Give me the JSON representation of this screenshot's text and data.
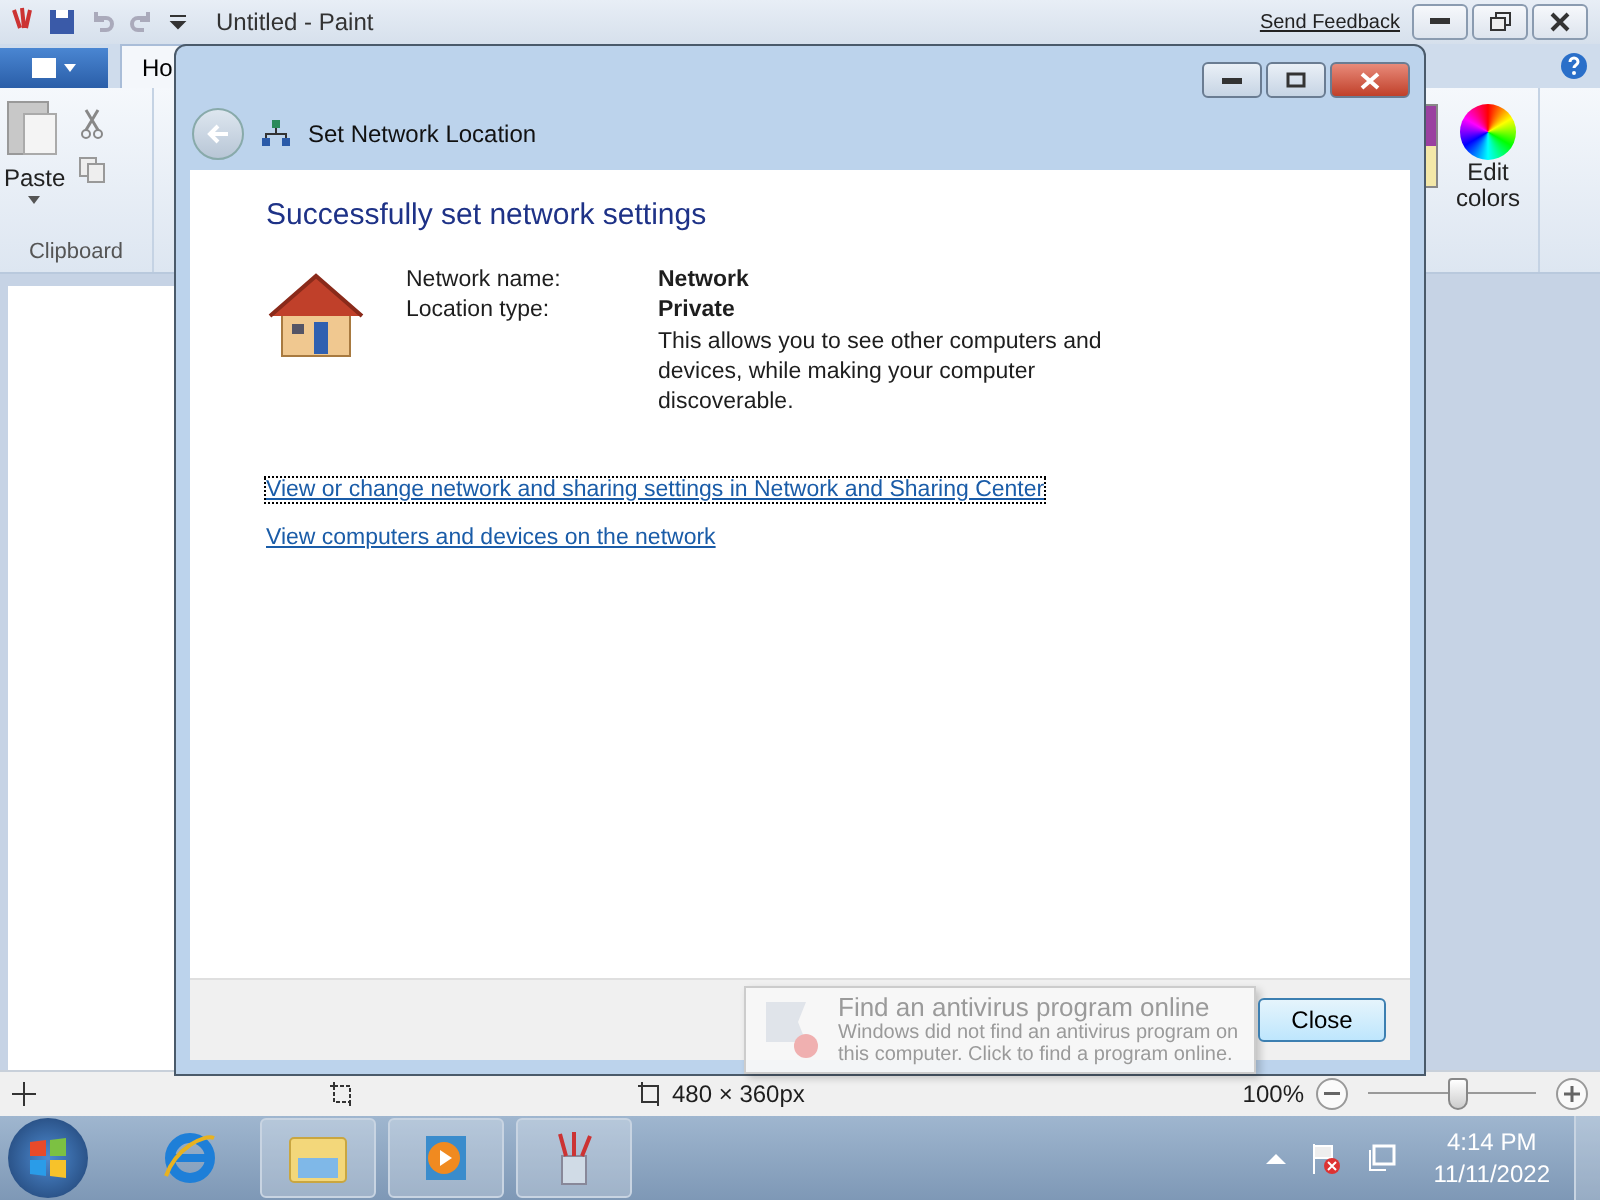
{
  "paint": {
    "title": "Untitled - Paint",
    "feedback": "Send Feedback",
    "home_tab": "Ho",
    "paste": "Paste",
    "clipboard": "Clipboard",
    "edit_colors": "Edit colors",
    "size": "480 × 360px",
    "zoom": "100%",
    "zoom_slider": {
      "level": 0.53
    }
  },
  "dialog": {
    "title": "Set Network Location",
    "heading": "Successfully set network settings",
    "fields": [
      {
        "label": "Network name:",
        "value": "Network"
      },
      {
        "label": "Location type:",
        "value": "Private"
      }
    ],
    "description": "This allows you to see other computers and devices, while making your computer discoverable.",
    "links": [
      "View or change network and sharing settings in Network and Sharing Center",
      "View computers and devices on the network"
    ],
    "close": "Close"
  },
  "balloon": {
    "title": "Find an antivirus program online",
    "body": "Windows did not find an antivirus program on this computer. Click to find a program online."
  },
  "taskbar": {
    "apps": [
      {
        "kind": "browser",
        "running": false
      },
      {
        "kind": "folder",
        "running": true
      },
      {
        "kind": "media",
        "running": true
      },
      {
        "kind": "paint",
        "running": true
      }
    ],
    "time": "4:14 PM",
    "date": "11/11/2022"
  }
}
